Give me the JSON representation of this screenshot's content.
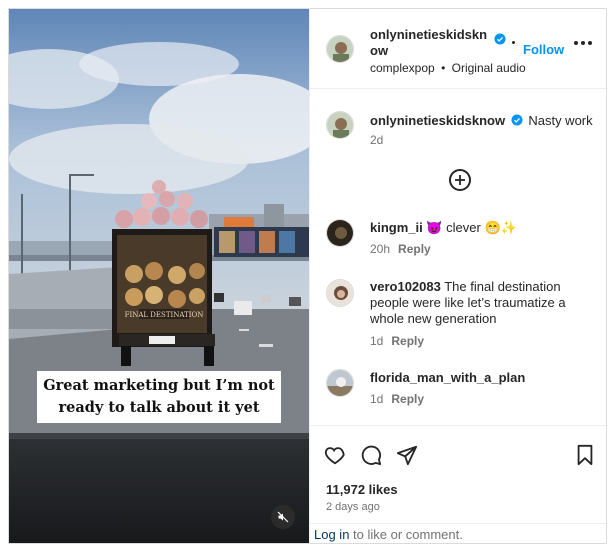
{
  "media": {
    "caption_line1": "Great marketing but I’m not",
    "caption_line2": "ready to talk about it yet",
    "truck_sign": "FINAL DESTINATION"
  },
  "header": {
    "username": "onlyninetieskidsknow",
    "follow_label": "Follow",
    "audio_account": "complexpop",
    "audio_separator": "•",
    "audio_label": "Original audio"
  },
  "post_caption": {
    "username": "onlyninetieskidsknow",
    "text": "Nasty work",
    "time": "2d"
  },
  "comments": [
    {
      "username": "kingm_ii",
      "text": "😈 clever 😁✨",
      "time": "20h",
      "reply_label": "Reply"
    },
    {
      "username": "vero102083",
      "text": "The final destination people were like let’s traumatize a whole new generation",
      "time": "1d",
      "reply_label": "Reply"
    },
    {
      "username": "florida_man_with_a_plan",
      "text": "",
      "time": "1d",
      "reply_label": "Reply"
    }
  ],
  "stats": {
    "likes": "11,972 likes",
    "date": "2 days ago"
  },
  "footer": {
    "login_link": "Log in",
    "login_rest": " to like or comment."
  },
  "colors": {
    "accent": "#0095f6",
    "verified": "#0095f6",
    "secondary_text": "#737373",
    "link": "#00376b"
  },
  "icons": [
    "verified-badge-icon",
    "more-options-icon",
    "add-comment-icon",
    "heart-icon",
    "comment-icon",
    "share-icon",
    "save-icon",
    "mute-icon"
  ]
}
